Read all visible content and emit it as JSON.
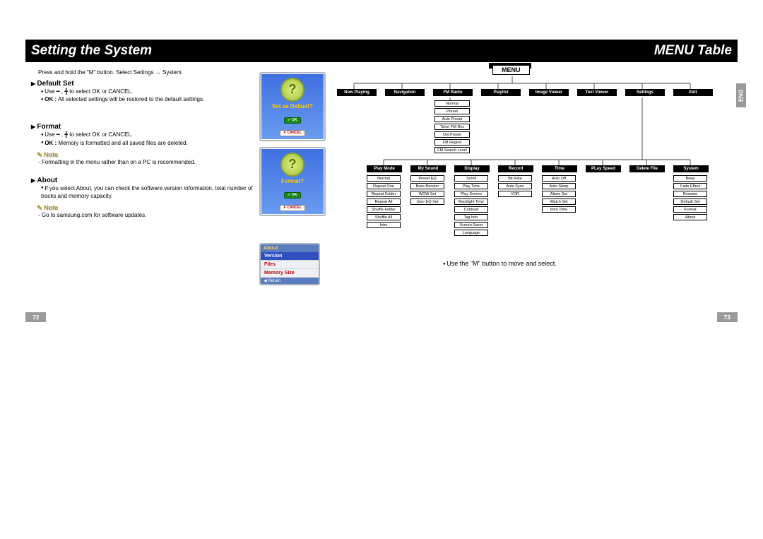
{
  "header": {
    "left": "Setting the System",
    "right": "MENU Table"
  },
  "left_page": {
    "intro": "Press and hold the \"M\" button. Select Settings → System.",
    "default_set": {
      "title": "Default Set",
      "b1": "Use ━ , ╋ to select OK or CANCEL.",
      "b2_label": "OK :",
      "b2_text": " All selected settings will be restored to the default settings."
    },
    "format": {
      "title": "Format",
      "b1": "Use ━ , ╋ to select OK or CANCEL.",
      "b2_label": "OK :",
      "b2_text": " Memory is formatted and all saved files are deleted."
    },
    "note1_label": "Note",
    "note1_text": "- Formatting in the menu rather than on a PC is recommended.",
    "about": {
      "title": "About",
      "b1": "If you select About, you can check the software version information, total number of tracks and memory capacity."
    },
    "note2_label": "Note",
    "note2_text": "- Go to samsung.com for software updates.",
    "page_num": "72"
  },
  "screens": {
    "s1_label": "Set as Default?",
    "s2_label": "Format?",
    "ok": "✓ OK",
    "cancel": "✗ CANCEL",
    "about": {
      "hdr": "About",
      "r1": "Version",
      "r2": "Files",
      "r3": "Memory Size",
      "ret": "◀ Return"
    }
  },
  "right_page": {
    "eng": "ENG",
    "menu": "MENU",
    "row1": [
      "Now Playing",
      "Navigation",
      "FM Radio",
      "Playlist",
      "Image Viewer",
      "Text Viewer",
      "Settings",
      "Exit"
    ],
    "fm_sub": [
      "Normal",
      "Preset",
      "Auto Preset",
      "Timer FM Rec",
      "Del.Preset",
      "FM Region",
      "FM Search Level"
    ],
    "row2": [
      "Play Mode",
      "My Sound",
      "Display",
      "Record",
      "Time",
      "PLay Speed",
      "Delete File",
      "System"
    ],
    "pm_sub": [
      "Normal",
      "Repeat One",
      "Repeat Folder",
      "Repeat All",
      "Shuffle Folder",
      "Shuffle All",
      "Intro"
    ],
    "ms_sub": [
      "Preset EQ",
      "Bass Booster",
      "WOW Set",
      "User EQ Set"
    ],
    "dp_sub": [
      "Scroll",
      "Play Time",
      "Play Screen",
      "Backlight Time",
      "Contrast",
      "Tag Info.",
      "Screen Saver",
      "Language"
    ],
    "rc_sub": [
      "Bit Rate",
      "Auto Sync",
      "VOR"
    ],
    "tm_sub": [
      "Auto Off",
      "Auto Sleep",
      "Alarm Set",
      "Watch Set",
      "Intro Time"
    ],
    "sy_sub": [
      "Beep",
      "Fade Effect",
      "Resume",
      "Default Set",
      "Format",
      "About"
    ],
    "instruction": "Use the \"M\" button to move and select.",
    "page_num": "73"
  }
}
